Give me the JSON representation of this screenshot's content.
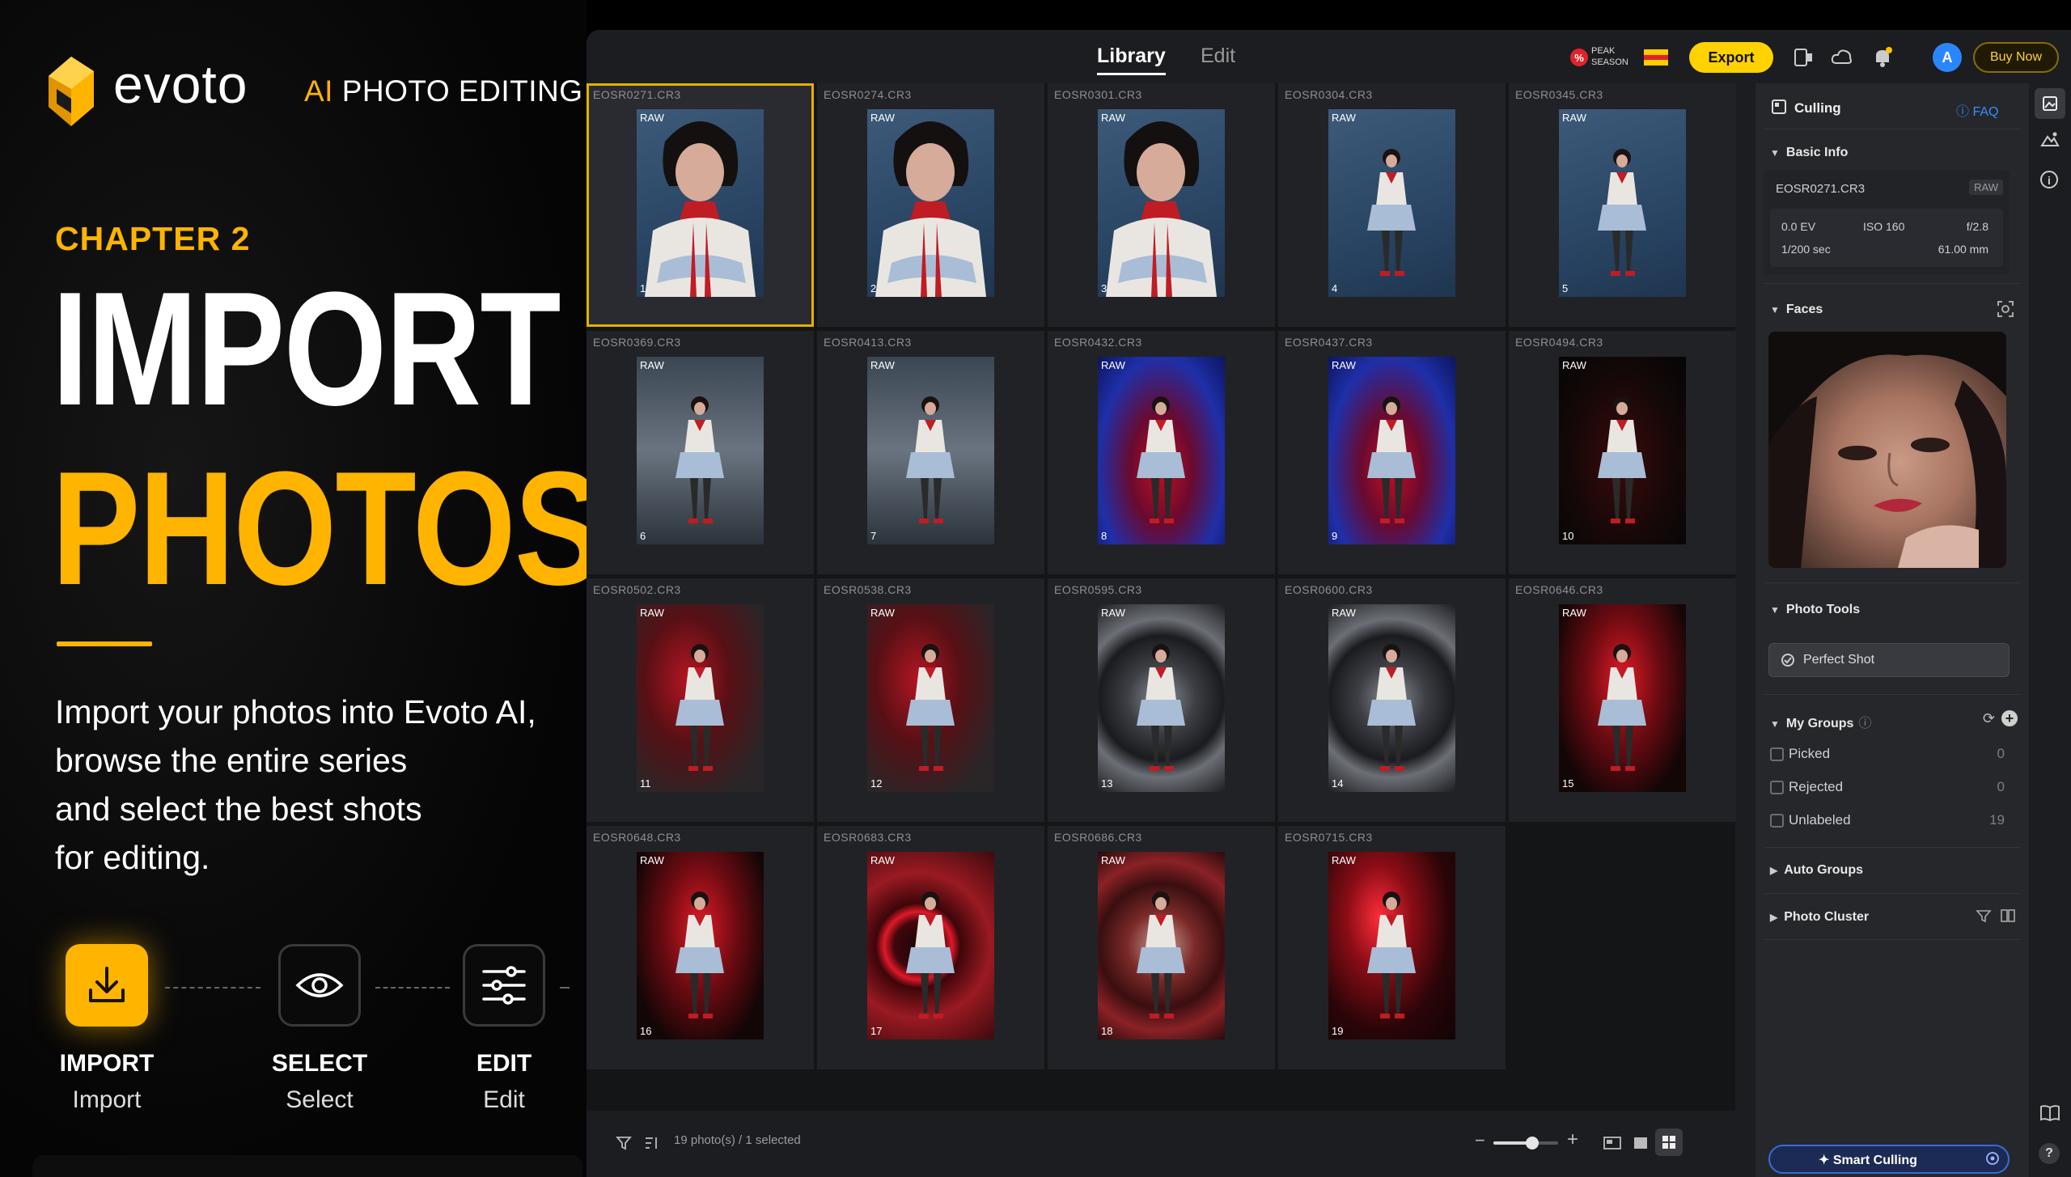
{
  "promo": {
    "brand": "evoto",
    "tagline_ai": "AI",
    "tagline_rest": " PHOTO EDITING",
    "chapter": "CHAPTER 2",
    "title_line1": "IMPORT",
    "title_line2": "PHOTOS",
    "description": [
      "Import your photos into Evoto AI,",
      "browse the entire series",
      "and select the best shots",
      "for editing."
    ],
    "steps": [
      {
        "title": "IMPORT",
        "sub": "Import",
        "icon": "download-icon"
      },
      {
        "title": "SELECT",
        "sub": "Select",
        "icon": "eye-icon"
      },
      {
        "title": "EDIT",
        "sub": "Edit",
        "icon": "sliders-icon"
      }
    ],
    "accent": "#ffb400"
  },
  "topbar": {
    "tabs": [
      "Library",
      "Edit"
    ],
    "active_tab": "Library",
    "peak_label": "PEAK SEASON",
    "export_label": "Export",
    "buy_label": "Buy Now",
    "avatar_letter": "A",
    "notification_count": "1"
  },
  "photos": [
    {
      "file": "EOSR0271.CR3",
      "raw": "RAW",
      "num": "1",
      "selected": true,
      "bg": "blue"
    },
    {
      "file": "EOSR0274.CR3",
      "raw": "RAW",
      "num": "2",
      "bg": "blue"
    },
    {
      "file": "EOSR0301.CR3",
      "raw": "RAW",
      "num": "3",
      "bg": "blue"
    },
    {
      "file": "EOSR0304.CR3",
      "raw": "RAW",
      "num": "4",
      "bg": "blue"
    },
    {
      "file": "EOSR0345.CR3",
      "raw": "RAW",
      "num": "5",
      "bg": "blue"
    },
    {
      "file": "EOSR0369.CR3",
      "raw": "RAW",
      "num": "6",
      "bg": "studio"
    },
    {
      "file": "EOSR0413.CR3",
      "raw": "RAW",
      "num": "7",
      "bg": "studio"
    },
    {
      "file": "EOSR0432.CR3",
      "raw": "RAW",
      "num": "8",
      "bg": "bluered"
    },
    {
      "file": "EOSR0437.CR3",
      "raw": "RAW",
      "num": "9",
      "bg": "bluered"
    },
    {
      "file": "EOSR0494.CR3",
      "raw": "RAW",
      "num": "10",
      "bg": "dark"
    },
    {
      "file": "EOSR0502.CR3",
      "raw": "RAW",
      "num": "11",
      "bg": "redgrad"
    },
    {
      "file": "EOSR0538.CR3",
      "raw": "RAW",
      "num": "12",
      "bg": "redgrad"
    },
    {
      "file": "EOSR0595.CR3",
      "raw": "RAW",
      "num": "13",
      "bg": "swirl"
    },
    {
      "file": "EOSR0600.CR3",
      "raw": "RAW",
      "num": "14",
      "bg": "swirl"
    },
    {
      "file": "EOSR0646.CR3",
      "raw": "RAW",
      "num": "15",
      "bg": "redglow"
    },
    {
      "file": "EOSR0648.CR3",
      "raw": "RAW",
      "num": "16",
      "bg": "redglow"
    },
    {
      "file": "EOSR0683.CR3",
      "raw": "RAW",
      "num": "17",
      "bg": "ring"
    },
    {
      "file": "EOSR0686.CR3",
      "raw": "RAW",
      "num": "18",
      "bg": "redswirl"
    },
    {
      "file": "EOSR0715.CR3",
      "raw": "RAW",
      "num": "19",
      "bg": "reddark"
    }
  ],
  "status": {
    "text": "19 photo(s) / 1 selected",
    "zoom_level": 0.6
  },
  "panel": {
    "culling_title": "Culling",
    "faq": "FAQ",
    "basic_info": {
      "title": "Basic Info",
      "filename": "EOSR0271.CR3",
      "raw": "RAW",
      "ev": "0.0 EV",
      "iso": "ISO 160",
      "aperture": "f/2.8",
      "shutter": "1/200 sec",
      "focal": "61.00 mm"
    },
    "faces_title": "Faces",
    "photo_tools_title": "Photo Tools",
    "perfect_shot": "Perfect Shot",
    "my_groups": {
      "title": "My Groups",
      "items": [
        {
          "label": "Picked",
          "count": "0"
        },
        {
          "label": "Rejected",
          "count": "0"
        },
        {
          "label": "Unlabeled",
          "count": "19"
        }
      ]
    },
    "auto_groups": "Auto Groups",
    "photo_cluster": "Photo Cluster",
    "smart_culling": "Smart Culling"
  }
}
